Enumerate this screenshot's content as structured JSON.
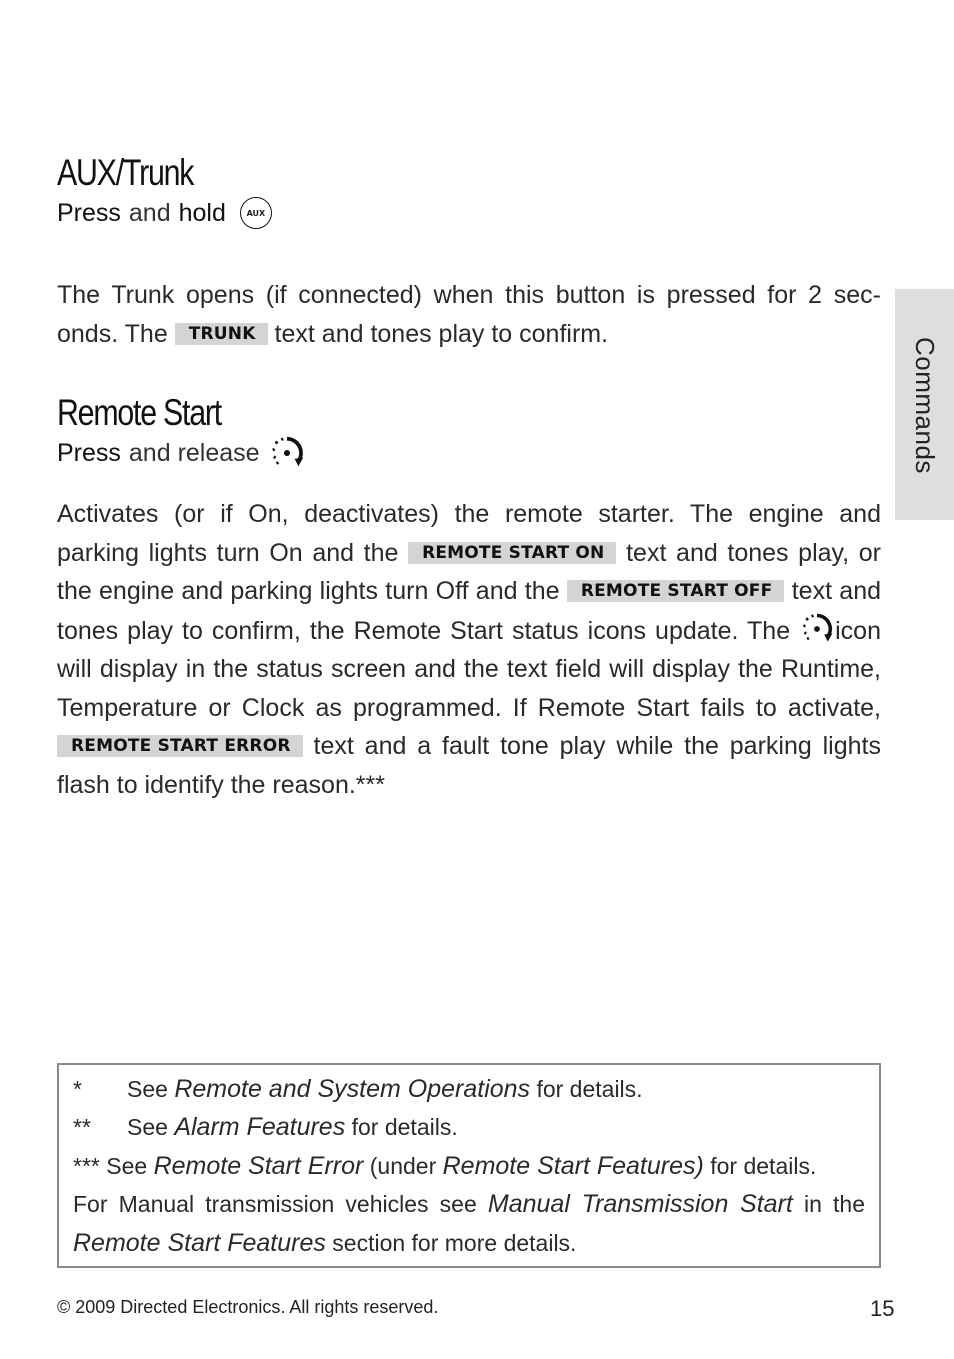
{
  "sections": [
    {
      "title": "AUX/Trunk",
      "action": {
        "strong1": "Press",
        "light": "and",
        "strong2": "hold",
        "button_icon": "aux-button-icon",
        "button_label": "AUX"
      },
      "body": {
        "part1": "The Trunk opens (if connected) when this button is pressed for 2 sec-onds. The",
        "tag1": "TRUNK",
        "part2": "text and tones play to confirm."
      }
    },
    {
      "title": "Remote Start",
      "action": {
        "strong1": "Press",
        "light": "and release",
        "button_icon": "remote-start-icon"
      },
      "body": {
        "part1": "Activates (or if On, deactivates) the remote starter. The engine and parking lights turn On and the",
        "tag1": "REMOTE START ON",
        "part2": "text and tones play, or the engine and parking lights turn Off and the",
        "tag2": "REMOTE START OFF",
        "part3": "text and tones play to confirm, the Remote Start status icons update. The",
        "part4": "icon will display in the status screen and the text field will display the Runtime, Temperature or Clock as programmed. If Remote Start fails to activate,",
        "tag3": "REMOTE START ERROR",
        "part5": "text and a fault tone play while the parking lights flash to identify the reason.***"
      }
    }
  ],
  "side_tab": {
    "label": "Commands"
  },
  "notes": [
    {
      "mark": "*",
      "pre": "See",
      "ref": "Remote and System Operations",
      "post": "for details."
    },
    {
      "mark": "**",
      "pre": "See",
      "ref": "Alarm Features",
      "post": "for details."
    },
    {
      "mark": "***",
      "pre": "See",
      "ref": "Remote Start Error",
      "mid": "(under",
      "ref2": "Remote Start Features)",
      "post": "for details."
    }
  ],
  "manual_note": {
    "pre": "For Manual transmission vehicles see",
    "ref": "Manual Transmission Start",
    "mid": "in the",
    "ref2": "Remote Start Features",
    "post": "section for more details."
  },
  "footer": {
    "copyright": "© 2009 Directed Electronics. All rights reserved.",
    "page_number": "15"
  }
}
